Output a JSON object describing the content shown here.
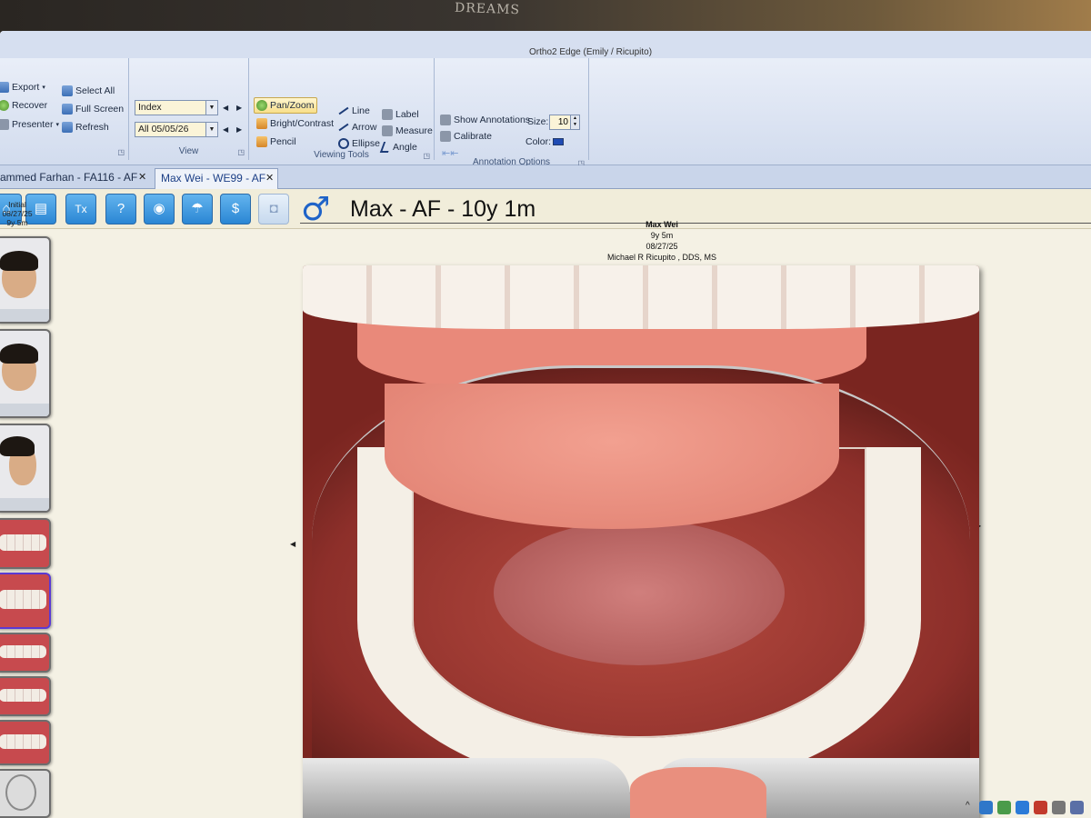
{
  "bezel_text": "DREAMS",
  "window": {
    "title": "Ortho2 Edge (Emily / Ricupito)"
  },
  "ribbon": {
    "file_group": {
      "export": "Export",
      "recover": "Recover",
      "presenter": "Presenter",
      "select_all": "Select All",
      "full_screen": "Full Screen",
      "refresh": "Refresh"
    },
    "view_group": {
      "label": "View",
      "sort_value": "Index",
      "date_value": "All  05/05/26"
    },
    "viewing_tools": {
      "label": "Viewing Tools",
      "pan_zoom": "Pan/Zoom",
      "bright_contrast": "Bright/Contrast",
      "pencil": "Pencil",
      "line": "Line",
      "arrow": "Arrow",
      "ellipse": "Ellipse",
      "label_tool": "Label",
      "measure": "Measure",
      "angle": "Angle"
    },
    "annotation_options": {
      "label": "Annotation Options",
      "show_annotations": "Show Annotations",
      "calibrate": "Calibrate",
      "size_label": "Size:",
      "size_value": "10",
      "color_label": "Color:",
      "color_value": "#1f4bb4"
    }
  },
  "tabs": [
    {
      "label": "ammed Farhan - FA116 - AF",
      "close": "✕",
      "active": false
    },
    {
      "label": "Max Wei - WE99 - AF",
      "close": "✕",
      "active": true
    }
  ],
  "toolbar": {
    "buttons": [
      {
        "name": "home-icon",
        "glyph": "⌂"
      },
      {
        "name": "chart-icon",
        "glyph": "▤"
      },
      {
        "name": "tx-icon",
        "glyph": "Tx"
      },
      {
        "name": "clipboard-icon",
        "glyph": "?"
      },
      {
        "name": "globe-icon",
        "glyph": "◉"
      },
      {
        "name": "umbrella-icon",
        "glyph": "☂"
      },
      {
        "name": "dollar-icon",
        "glyph": "$"
      },
      {
        "name": "camera-icon",
        "glyph": "◘"
      }
    ],
    "gender_symbol": "♂",
    "patient_title": "Max - AF - 10y 1m"
  },
  "thumbnails": {
    "caption_line1": "Initial",
    "caption_line2": "08/27/25",
    "caption_line3": "9y 5m"
  },
  "image": {
    "patient_name": "Max Wei",
    "age": "9y 5m",
    "date": "08/27/25",
    "doctor": "Michael R Ricupito , DDS, MS"
  },
  "colors": {
    "accent": "#2a86d4",
    "selected_thumb": "#5a3ad4",
    "gender": "#1e63c8"
  }
}
